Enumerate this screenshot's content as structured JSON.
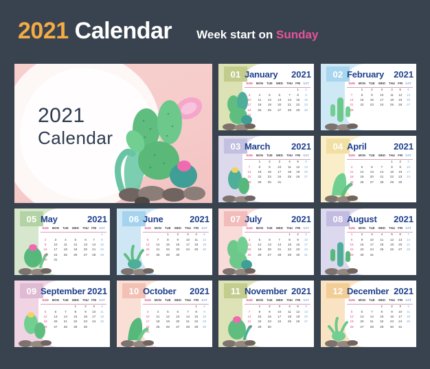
{
  "header": {
    "year": "2021",
    "calendar_word": "Calendar",
    "note_prefix": "Week start on ",
    "note_highlight": "Sunday",
    "year_color": "#f5ab43",
    "calendar_color": "#ffffff",
    "highlight_color": "#e8529a",
    "page_background": "#38434f"
  },
  "cover": {
    "line1": "2021",
    "line2": "Calendar",
    "background": "#f3c8c7",
    "text_color": "#2b3a4f",
    "art": "cactus-rocks-illustration"
  },
  "calendar": {
    "year": "2021",
    "week_start": "Sunday",
    "weekdays": [
      "SUN",
      "MON",
      "TUE",
      "WED",
      "THU",
      "FRI",
      "SAT"
    ],
    "sunday_color": "#e0457c",
    "saturday_color": "#7aa8df",
    "month_title_color": "#20418c"
  },
  "months": [
    {
      "num": "01",
      "name": "January",
      "year": "2021",
      "bg": "#dde2b4",
      "badge_bg": "#c2cc8c",
      "art": "prickly-pear-cactus-pink-flower",
      "weeks": [
        [
          "",
          "",
          "",
          "",
          "",
          "1",
          "2"
        ],
        [
          "3",
          "4",
          "5",
          "6",
          "7",
          "8",
          "9"
        ],
        [
          "10",
          "11",
          "12",
          "13",
          "14",
          "15",
          "16"
        ],
        [
          "17",
          "18",
          "19",
          "20",
          "21",
          "22",
          "23"
        ],
        [
          "24",
          "25",
          "26",
          "27",
          "28",
          "29",
          "30"
        ],
        [
          "31",
          "",
          "",
          "",
          "",
          "",
          ""
        ]
      ]
    },
    {
      "num": "02",
      "name": "February",
      "year": "2021",
      "bg": "#cfe8f6",
      "badge_bg": "#a8d6ee",
      "art": "tall-cactus-rocks",
      "weeks": [
        [
          "",
          "1",
          "2",
          "3",
          "4",
          "5",
          "6"
        ],
        [
          "7",
          "8",
          "9",
          "10",
          "11",
          "12",
          "13"
        ],
        [
          "14",
          "15",
          "16",
          "17",
          "18",
          "19",
          "20"
        ],
        [
          "21",
          "22",
          "23",
          "24",
          "25",
          "26",
          "27"
        ],
        [
          "28",
          "",
          "",
          "",
          "",
          "",
          ""
        ],
        [
          "",
          "",
          "",
          "",
          "",
          "",
          ""
        ]
      ]
    },
    {
      "num": "03",
      "name": "March",
      "year": "2021",
      "bg": "#dcd9ec",
      "badge_bg": "#c3bfe0",
      "art": "cactus-yellow-flower-rocks",
      "weeks": [
        [
          "",
          "1",
          "2",
          "3",
          "4",
          "5",
          "6"
        ],
        [
          "7",
          "8",
          "9",
          "10",
          "11",
          "12",
          "13"
        ],
        [
          "14",
          "15",
          "16",
          "17",
          "18",
          "19",
          "20"
        ],
        [
          "21",
          "22",
          "23",
          "24",
          "25",
          "26",
          "27"
        ],
        [
          "28",
          "29",
          "30",
          "31",
          "",
          "",
          ""
        ],
        [
          "",
          "",
          "",
          "",
          "",
          "",
          ""
        ]
      ]
    },
    {
      "num": "04",
      "name": "April",
      "year": "2021",
      "bg": "#faeec8",
      "badge_bg": "#f2dfa4",
      "art": "saguaro-cactus-red-plant",
      "weeks": [
        [
          "",
          "",
          "",
          "",
          "1",
          "2",
          "3"
        ],
        [
          "4",
          "5",
          "6",
          "7",
          "8",
          "9",
          "10"
        ],
        [
          "11",
          "12",
          "13",
          "14",
          "15",
          "16",
          "17"
        ],
        [
          "18",
          "19",
          "20",
          "21",
          "22",
          "23",
          "24"
        ],
        [
          "25",
          "26",
          "27",
          "28",
          "29",
          "30",
          ""
        ],
        [
          "",
          "",
          "",
          "",
          "",
          "",
          ""
        ]
      ]
    },
    {
      "num": "05",
      "name": "May",
      "year": "2021",
      "bg": "#d7e7cd",
      "badge_bg": "#b4d3a4",
      "art": "barrel-cactus-pink-bloom",
      "weeks": [
        [
          "",
          "",
          "",
          "",
          "",
          "",
          "1"
        ],
        [
          "2",
          "3",
          "4",
          "5",
          "6",
          "7",
          "8"
        ],
        [
          "9",
          "10",
          "11",
          "12",
          "13",
          "14",
          "15"
        ],
        [
          "16",
          "17",
          "18",
          "19",
          "20",
          "21",
          "22"
        ],
        [
          "23",
          "24",
          "25",
          "26",
          "27",
          "28",
          "29"
        ],
        [
          "30",
          "31",
          "",
          "",
          "",
          "",
          ""
        ]
      ]
    },
    {
      "num": "06",
      "name": "June",
      "year": "2021",
      "bg": "#cfe6f5",
      "badge_bg": "#a5d3ee",
      "art": "prickly-pear-cluster",
      "weeks": [
        [
          "",
          "",
          "1",
          "2",
          "3",
          "4",
          "5"
        ],
        [
          "6",
          "7",
          "8",
          "9",
          "10",
          "11",
          "12"
        ],
        [
          "13",
          "14",
          "15",
          "16",
          "17",
          "18",
          "19"
        ],
        [
          "20",
          "21",
          "22",
          "23",
          "24",
          "25",
          "26"
        ],
        [
          "27",
          "28",
          "29",
          "30",
          "",
          "",
          ""
        ],
        [
          "",
          "",
          "",
          "",
          "",
          "",
          ""
        ]
      ]
    },
    {
      "num": "07",
      "name": "July",
      "year": "2021",
      "bg": "#f9dbd9",
      "badge_bg": "#f2bcbb",
      "art": "round-cactus-rocks",
      "weeks": [
        [
          "",
          "",
          "",
          "",
          "1",
          "2",
          "3"
        ],
        [
          "4",
          "5",
          "6",
          "7",
          "8",
          "9",
          "10"
        ],
        [
          "11",
          "12",
          "13",
          "14",
          "15",
          "16",
          "17"
        ],
        [
          "18",
          "19",
          "20",
          "21",
          "22",
          "23",
          "24"
        ],
        [
          "25",
          "26",
          "27",
          "28",
          "29",
          "30",
          "31"
        ],
        [
          "",
          "",
          "",
          "",
          "",
          "",
          ""
        ]
      ]
    },
    {
      "num": "08",
      "name": "August",
      "year": "2021",
      "bg": "#dcd8ed",
      "badge_bg": "#c2bce1",
      "art": "agave-succulent-rocks",
      "weeks": [
        [
          "1",
          "2",
          "3",
          "4",
          "5",
          "6",
          "7"
        ],
        [
          "8",
          "9",
          "10",
          "11",
          "12",
          "13",
          "14"
        ],
        [
          "15",
          "16",
          "17",
          "18",
          "19",
          "20",
          "21"
        ],
        [
          "22",
          "23",
          "24",
          "25",
          "26",
          "27",
          "28"
        ],
        [
          "29",
          "30",
          "31",
          "",
          "",
          "",
          ""
        ],
        [
          "",
          "",
          "",
          "",
          "",
          "",
          ""
        ]
      ]
    },
    {
      "num": "09",
      "name": "September",
      "year": "2021",
      "bg": "#f0d4e4",
      "badge_bg": "#debbd2",
      "art": "tall-cactus-orange-flower",
      "weeks": [
        [
          "",
          "",
          "",
          "1",
          "2",
          "3",
          "4"
        ],
        [
          "5",
          "6",
          "7",
          "8",
          "9",
          "10",
          "11"
        ],
        [
          "12",
          "13",
          "14",
          "15",
          "16",
          "17",
          "18"
        ],
        [
          "19",
          "20",
          "21",
          "22",
          "23",
          "24",
          "25"
        ],
        [
          "26",
          "27",
          "28",
          "29",
          "30",
          "",
          ""
        ],
        [
          "",
          "",
          "",
          "",
          "",
          "",
          ""
        ]
      ]
    },
    {
      "num": "10",
      "name": "October",
      "year": "2021",
      "bg": "#fadfd6",
      "badge_bg": "#f2c1b4",
      "art": "bunny-ear-cactus-red-plant",
      "weeks": [
        [
          "",
          "",
          "",
          "",
          "",
          "1",
          "2"
        ],
        [
          "3",
          "4",
          "5",
          "6",
          "7",
          "8",
          "9"
        ],
        [
          "10",
          "11",
          "12",
          "13",
          "14",
          "15",
          "16"
        ],
        [
          "17",
          "18",
          "19",
          "20",
          "21",
          "22",
          "23"
        ],
        [
          "24",
          "25",
          "26",
          "27",
          "28",
          "29",
          "30"
        ],
        [
          "31",
          "",
          "",
          "",
          "",
          "",
          ""
        ]
      ]
    },
    {
      "num": "11",
      "name": "November",
      "year": "2021",
      "bg": "#dde3b6",
      "badge_bg": "#c3cd8e",
      "art": "pastel-succulent-cluster",
      "weeks": [
        [
          "",
          "1",
          "2",
          "3",
          "4",
          "5",
          "6"
        ],
        [
          "7",
          "8",
          "9",
          "10",
          "11",
          "12",
          "13"
        ],
        [
          "14",
          "15",
          "16",
          "17",
          "18",
          "19",
          "20"
        ],
        [
          "21",
          "22",
          "23",
          "24",
          "25",
          "26",
          "27"
        ],
        [
          "28",
          "29",
          "30",
          "",
          "",
          "",
          ""
        ],
        [
          "",
          "",
          "",
          "",
          "",
          "",
          ""
        ]
      ]
    },
    {
      "num": "12",
      "name": "December",
      "year": "2021",
      "bg": "#fae3c2",
      "badge_bg": "#f2cd95",
      "art": "columnar-cactus-purple-flowers",
      "weeks": [
        [
          "",
          "",
          "",
          "1",
          "2",
          "3",
          "4"
        ],
        [
          "5",
          "6",
          "7",
          "8",
          "9",
          "10",
          "11"
        ],
        [
          "12",
          "13",
          "14",
          "15",
          "16",
          "17",
          "18"
        ],
        [
          "19",
          "20",
          "21",
          "22",
          "23",
          "24",
          "25"
        ],
        [
          "26",
          "27",
          "28",
          "29",
          "30",
          "31",
          ""
        ],
        [
          "",
          "",
          "",
          "",
          "",
          "",
          ""
        ]
      ]
    }
  ]
}
